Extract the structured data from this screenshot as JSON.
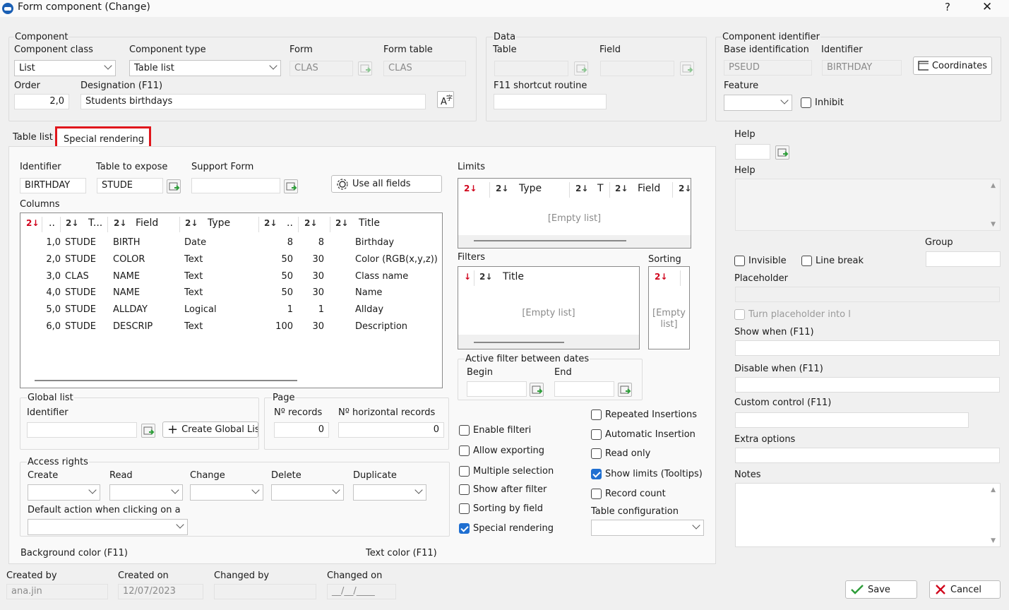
{
  "window": {
    "title": "Form component (Change)",
    "help": "?",
    "close": "✕"
  },
  "component": {
    "group": "Component",
    "class_label": "Component class",
    "class_value": "List",
    "type_label": "Component type",
    "type_value": "Table list",
    "form_label": "Form",
    "form_value": "CLAS",
    "form_table_label": "Form table",
    "form_table_value": "CLAS",
    "order_label": "Order",
    "order_value": "2,0",
    "designation_label": "Designation (F11)",
    "designation_value": "Students birthdays"
  },
  "data": {
    "group": "Data",
    "table_label": "Table",
    "field_label": "Field",
    "f11_label": "F11 shortcut routine"
  },
  "identifier_group": {
    "group": "Component identifier",
    "base_label": "Base identification",
    "base_value": "PSEUD",
    "id_label": "Identifier",
    "id_value": "BIRTHDAY",
    "coordinates": "Coordinates",
    "feature_label": "Feature",
    "inhibit_label": "Inhibit"
  },
  "tabs": {
    "table_list": "Table list",
    "special_rendering": "Special rendering"
  },
  "table_list": {
    "identifier_label": "Identifier",
    "identifier_value": "BIRTHDAY",
    "expose_label": "Table to expose",
    "expose_value": "STUDE",
    "support_label": "Support Form",
    "use_all_fields": "Use all fields",
    "columns_label": "Columns",
    "columns_headers": [
      "..",
      "T...",
      "Field",
      "Type",
      "..",
      "Title"
    ],
    "columns_rows": [
      [
        "1,0",
        "STUDE",
        "BIRTH",
        "Date",
        "8",
        "8",
        "Birthday"
      ],
      [
        "2,0",
        "STUDE",
        "COLOR",
        "Text",
        "50",
        "30",
        "Color (RGB(x,y,z))"
      ],
      [
        "3,0",
        "CLAS",
        "NAME",
        "Text",
        "50",
        "30",
        "Class name"
      ],
      [
        "4,0",
        "STUDE",
        "NAME",
        "Text",
        "50",
        "30",
        "Name"
      ],
      [
        "5,0",
        "STUDE",
        "ALLDAY",
        "Logical",
        "1",
        "1",
        "Allday"
      ],
      [
        "6,0",
        "STUDE",
        "DESCRIP",
        "Text",
        "100",
        "30",
        "Description"
      ]
    ]
  },
  "global_list": {
    "group": "Global list",
    "identifier_label": "Identifier",
    "create": "Create Global Lis"
  },
  "page": {
    "group": "Page",
    "records_label": "Nº records",
    "records_value": "0",
    "horizontal_label": "Nº horizontal records",
    "horizontal_value": "0"
  },
  "access": {
    "group": "Access rights",
    "create": "Create",
    "read": "Read",
    "change": "Change",
    "delete": "Delete",
    "duplicate": "Duplicate",
    "default_action": "Default action when clicking on a"
  },
  "colors": {
    "background": "Background color (F11)",
    "text": "Text color (F11)"
  },
  "limits": {
    "label": "Limits",
    "type": "Type",
    "t": "T",
    "field": "Field",
    "empty": "[Empty list]"
  },
  "filters": {
    "label": "Filters",
    "title": "Title",
    "empty": "[Empty list]"
  },
  "sorting": {
    "label": "Sorting",
    "empty1": "[Empty",
    "empty2": "list]"
  },
  "active_filter": {
    "group": "Active filter between dates",
    "begin": "Begin",
    "end": "End"
  },
  "checks_left": [
    {
      "label": "Enable filteri",
      "on": false
    },
    {
      "label": "Allow exporting",
      "on": false
    },
    {
      "label": "Multiple selection",
      "on": false
    },
    {
      "label": "Show after filter",
      "on": false
    },
    {
      "label": "Sorting by field",
      "on": false
    },
    {
      "label": "Special rendering",
      "on": true
    }
  ],
  "checks_right": [
    {
      "label": "Repeated Insertions",
      "on": false
    },
    {
      "label": "Automatic Insertion",
      "on": false
    },
    {
      "label": "Read only",
      "on": false
    },
    {
      "label": "Show limits (Tooltips)",
      "on": true
    },
    {
      "label": "Record count",
      "on": false
    }
  ],
  "table_config": "Table configuration",
  "right_panel": {
    "help1": "Help",
    "help2": "Help",
    "group": "Group",
    "invisible": "Invisible",
    "line_break": "Line break",
    "placeholder": "Placeholder",
    "turn_placeholder": "Turn placeholder into l",
    "show_when": "Show when (F11)",
    "disable_when": "Disable when (F11)",
    "custom_control": "Custom control (F11)",
    "extra_options": "Extra options",
    "notes": "Notes"
  },
  "footer": {
    "created_by": "Created by",
    "created_by_value": "ana.jin",
    "created_on": "Created on",
    "created_on_value": "12/07/2023",
    "changed_by": "Changed by",
    "changed_on": "Changed on",
    "changed_on_value": "__/__/____",
    "save": "Save",
    "cancel": "Cancel"
  },
  "colors_hex": {
    "highlight": "#e0161c",
    "accent": "#1f6fd1"
  }
}
